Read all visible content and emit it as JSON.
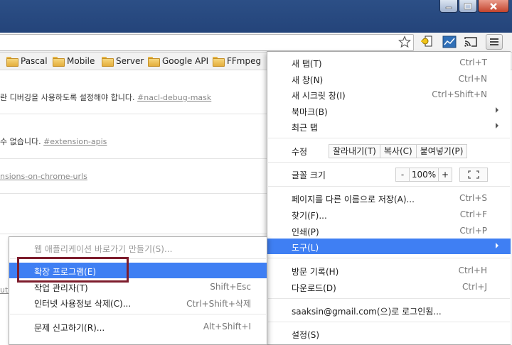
{
  "bookmarks": [
    {
      "label": "Pascal"
    },
    {
      "label": "Mobile"
    },
    {
      "label": "Server"
    },
    {
      "label": "Google API"
    },
    {
      "label": "FFmpeg"
    }
  ],
  "content": {
    "row1_text": "란 디버깅을 사용하도록 설정해야 합니다. ",
    "row1_link": "#nacl-debug-mask",
    "row2_text": "수 없습니다. ",
    "row2_link": "#extension-apis",
    "row3_link": "nsions-on-chrome-urls",
    "row4_link": "ute"
  },
  "menu": {
    "new_tab": {
      "label": "새 탭(T)",
      "shortcut": "Ctrl+T"
    },
    "new_window": {
      "label": "새 창(N)",
      "shortcut": "Ctrl+N"
    },
    "incognito": {
      "label": "새 시크릿 창(I)",
      "shortcut": "Ctrl+Shift+N"
    },
    "bookmarks": {
      "label": "북마크(B)"
    },
    "recent_tabs": {
      "label": "최근 탭"
    },
    "edit": {
      "label": "수정",
      "cut": "잘라내기(T)",
      "copy": "복사(C)",
      "paste": "붙여넣기(P)"
    },
    "zoom": {
      "label": "글꼴 크기",
      "minus": "-",
      "value": "100%",
      "plus": "+"
    },
    "save_as": {
      "label": "페이지를 다른 이름으로 저장(A)...",
      "shortcut": "Ctrl+S"
    },
    "find": {
      "label": "찾기(F)...",
      "shortcut": "Ctrl+F"
    },
    "print": {
      "label": "인쇄(P)",
      "shortcut": "Ctrl+P"
    },
    "tools": {
      "label": "도구(L)"
    },
    "history": {
      "label": "방문 기록(H)",
      "shortcut": "Ctrl+H"
    },
    "downloads": {
      "label": "다운로드(D)",
      "shortcut": "Ctrl+J"
    },
    "signin": {
      "label": "saaksin@gmail.com(으)로 로그인됨..."
    },
    "settings": {
      "label": "설정(S)"
    }
  },
  "submenu": {
    "create_shortcut": {
      "label": "웹 애플리케이션 바로가기 만들기(S)..."
    },
    "extensions": {
      "label": "확장 프로그램(E)"
    },
    "task_manager": {
      "label": "작업 관리자(T)",
      "shortcut": "Shift+Esc"
    },
    "clear_data": {
      "label": "인터넷 사용정보 삭제(C)...",
      "shortcut": "Ctrl+Shift+삭제"
    },
    "report_issue": {
      "label": "문제 신고하기(R)...",
      "shortcut": "Alt+Shift+I"
    }
  },
  "colors": {
    "highlight": "#3f7ff3",
    "annotation_box": "#7d1c2c",
    "titlebar": "#2c4f86"
  }
}
